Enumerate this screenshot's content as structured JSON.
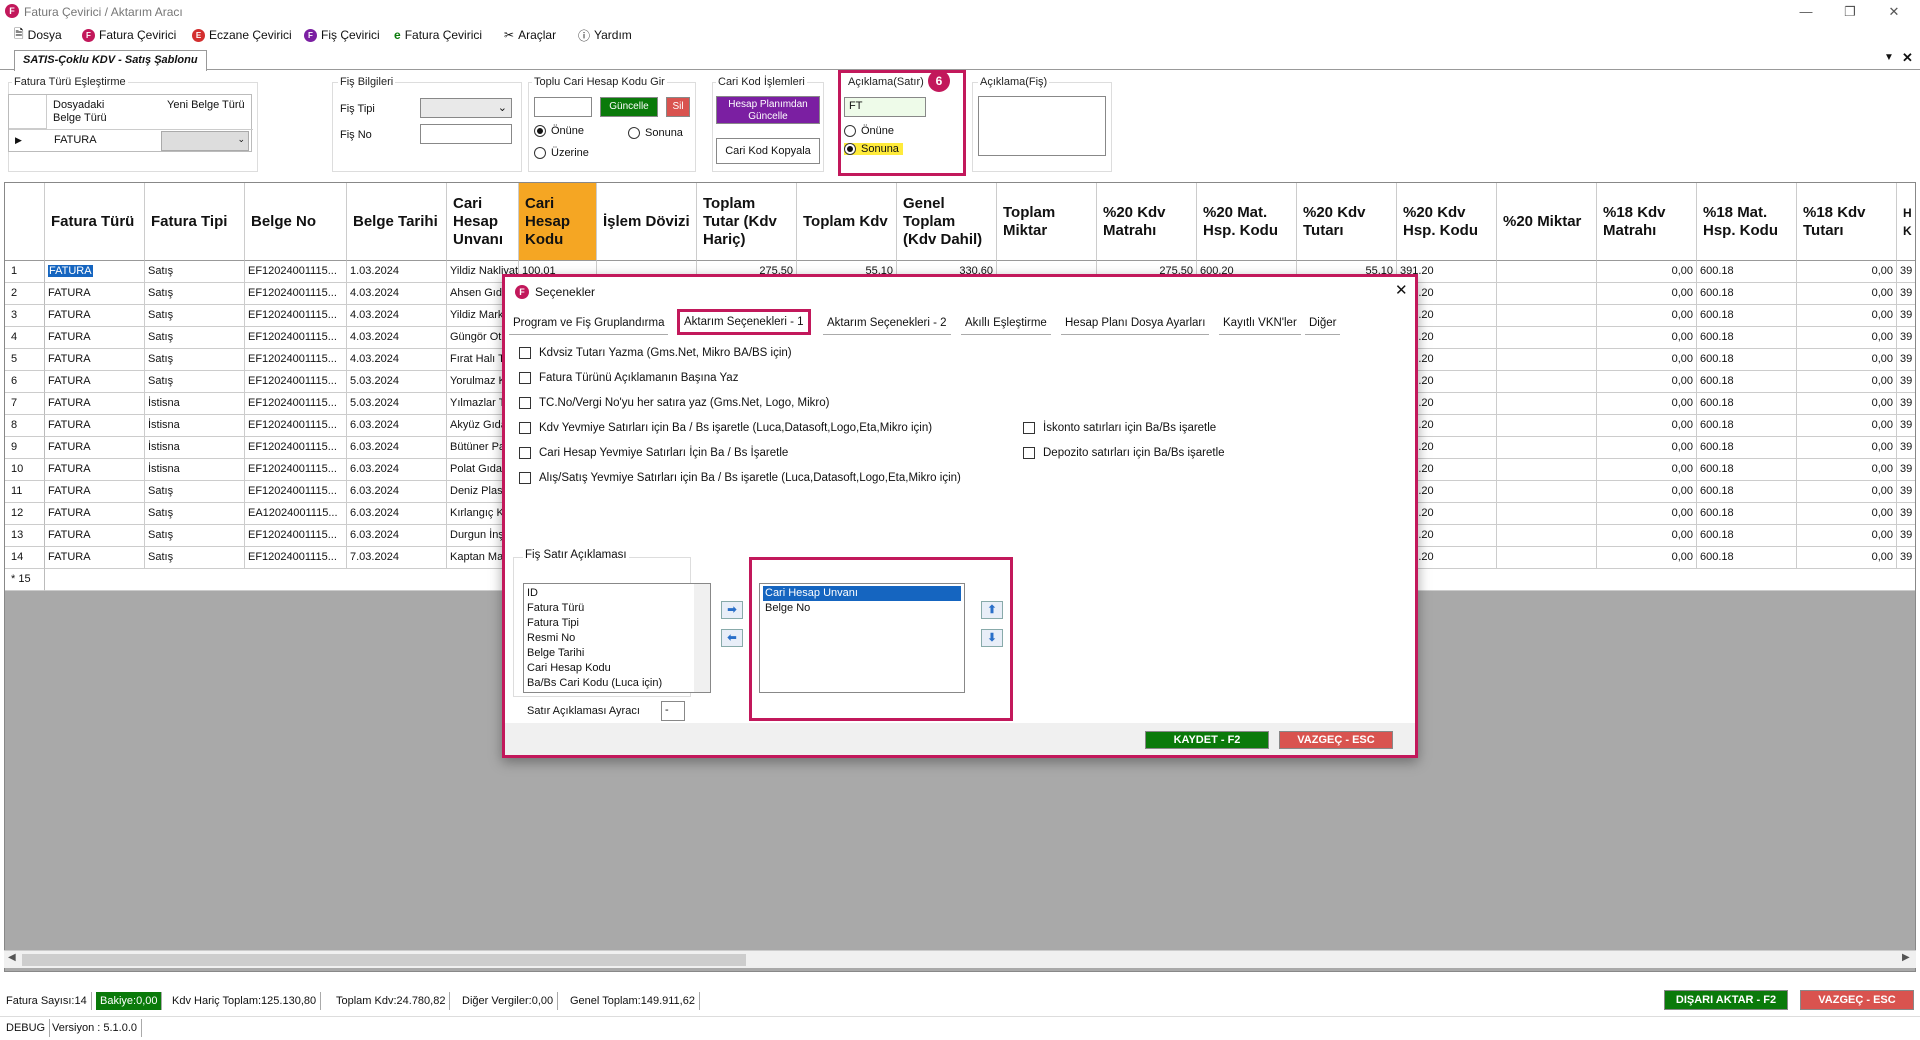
{
  "app": {
    "title": "Fatura Çevirici / Aktarım Aracı"
  },
  "menu": {
    "items": [
      "Dosya",
      "Fatura Çevirici",
      "Eczane Çevirici",
      "Fiş Çevirici",
      "Fatura Çevirici",
      "Araçlar",
      "Yardım"
    ]
  },
  "doc_tab": "SATIS-Çoklu KDV - Satış Şablonu",
  "toolbar": {
    "fatura_turu_group": "Fatura Türü Eşleştirme",
    "col_dosya": "Dosyadaki Belge Türü",
    "col_yeni": "Yeni Belge Türü",
    "row_value": "FATURA",
    "fis_group": "Fiş Bilgileri",
    "fis_tipi": "Fiş Tipi",
    "fis_no": "Fiş No",
    "toplu_group": "Toplu Cari Hesap Kodu Gir",
    "guncelle": "Güncelle",
    "sil": "Sil",
    "onune": "Önüne",
    "sonuna": "Sonuna",
    "uzerine": "Üzerine",
    "cari_group": "Cari Kod İşlemleri",
    "hesap_plan": "Hesap Planımdan Güncelle",
    "cari_kopyala": "Cari Kod Kopyala",
    "aciklama_satir": "Açıklama(Satır)",
    "aciklama_value": "FT",
    "badge": "6",
    "aciklama_fis": "Açıklama(Fiş)"
  },
  "grid": {
    "headers": [
      "Fatura Türü",
      "Fatura Tipi",
      "Belge No",
      "Belge Tarihi",
      "Cari Hesap Unvanı",
      "Cari Hesap Kodu",
      "İşlem Dövizi",
      "Toplam Tutar (Kdv Hariç)",
      "Toplam Kdv",
      "Genel Toplam (Kdv Dahil)",
      "Toplam Miktar",
      "%20 Kdv Matrahı",
      "%20 Mat. Hsp. Kodu",
      "%20 Kdv Tutarı",
      "%20 Kdv Hsp. Kodu",
      "%20 Miktar",
      "%18 Kdv Matrahı",
      "%18 Mat. Hsp. Kodu",
      "%18 Kdv Tutarı",
      "H K"
    ],
    "rows": [
      [
        "1",
        "FATURA",
        "Satış",
        "EF12024001115...",
        "1.03.2024",
        "Yildiz Nakliyat",
        "100.01",
        "",
        "275,50",
        "55,10",
        "330,60",
        "",
        "275,50",
        "600.20",
        "55,10",
        "391.20",
        "",
        "0,00",
        "600.18",
        "0,00",
        "39"
      ],
      [
        "2",
        "FATURA",
        "Satış",
        "EF12024001115...",
        "4.03.2024",
        "Ahsen Gıd...",
        "",
        "",
        "",
        "",
        "",
        "",
        "",
        "",
        "",
        "391.20",
        "",
        "0,00",
        "600.18",
        "0,00",
        "39"
      ],
      [
        "3",
        "FATURA",
        "Satış",
        "EF12024001115...",
        "4.03.2024",
        "Yildiz Mark...",
        "",
        "",
        "",
        "",
        "",
        "",
        "",
        "",
        "",
        "391.20",
        "",
        "0,00",
        "600.18",
        "0,00",
        "39"
      ],
      [
        "4",
        "FATURA",
        "Satış",
        "EF12024001115...",
        "4.03.2024",
        "Güngör Ot...",
        "",
        "",
        "",
        "",
        "",
        "",
        "",
        "",
        "",
        "391.20",
        "",
        "0,00",
        "600.18",
        "0,00",
        "39"
      ],
      [
        "5",
        "FATURA",
        "Satış",
        "EF12024001115...",
        "4.03.2024",
        "Fırat Halı T...",
        "",
        "",
        "",
        "",
        "",
        "",
        "",
        "",
        "",
        "391.20",
        "",
        "0,00",
        "600.18",
        "0,00",
        "39"
      ],
      [
        "6",
        "FATURA",
        "Satış",
        "EF12024001115...",
        "5.03.2024",
        "Yorulmaz K...",
        "",
        "",
        "",
        "",
        "",
        "",
        "",
        "",
        "",
        "391.20",
        "",
        "0,00",
        "600.18",
        "0,00",
        "39"
      ],
      [
        "7",
        "FATURA",
        "İstisna",
        "EF12024001115...",
        "5.03.2024",
        "Yılmazlar T...",
        "",
        "",
        "",
        "",
        "",
        "",
        "",
        "",
        "",
        "391.20",
        "",
        "0,00",
        "600.18",
        "0,00",
        "39"
      ],
      [
        "8",
        "FATURA",
        "İstisna",
        "EF12024001115...",
        "6.03.2024",
        "Akyüz Gıda...",
        "",
        "",
        "",
        "",
        "",
        "",
        "",
        "",
        "",
        "391.20",
        "",
        "0,00",
        "600.18",
        "0,00",
        "39"
      ],
      [
        "9",
        "FATURA",
        "İstisna",
        "EF12024001115...",
        "6.03.2024",
        "Bütüner Pa...",
        "",
        "",
        "",
        "",
        "",
        "",
        "",
        "",
        "",
        "391.20",
        "",
        "0,00",
        "600.18",
        "0,00",
        "39"
      ],
      [
        "10",
        "FATURA",
        "İstisna",
        "EF12024001115...",
        "6.03.2024",
        "Polat Gıda ...",
        "",
        "",
        "",
        "",
        "",
        "",
        "",
        "",
        "",
        "391.20",
        "",
        "0,00",
        "600.18",
        "0,00",
        "39"
      ],
      [
        "11",
        "FATURA",
        "Satış",
        "EF12024001115...",
        "6.03.2024",
        "Deniz Plast...",
        "",
        "",
        "",
        "",
        "",
        "",
        "",
        "",
        "",
        "391.20",
        "",
        "0,00",
        "600.18",
        "0,00",
        "39"
      ],
      [
        "12",
        "FATURA",
        "Satış",
        "EA12024001115...",
        "6.03.2024",
        "Kırlangıç Ki...",
        "",
        "",
        "",
        "",
        "",
        "",
        "",
        "",
        "",
        "391.20",
        "",
        "0,00",
        "600.18",
        "0,00",
        "39"
      ],
      [
        "13",
        "FATURA",
        "Satış",
        "EF12024001115...",
        "6.03.2024",
        "Durgun İnş...",
        "",
        "",
        "",
        "",
        "",
        "",
        "",
        "",
        "",
        "391.20",
        "",
        "0,00",
        "600.18",
        "0,00",
        "39"
      ],
      [
        "14",
        "FATURA",
        "Satış",
        "EF12024001115...",
        "7.03.2024",
        "Kaptan Ma...",
        "",
        "",
        "",
        "",
        "",
        "",
        "",
        "",
        "",
        "391.20",
        "",
        "0,00",
        "600.18",
        "0,00",
        "39"
      ]
    ],
    "new_row": "* 15"
  },
  "status": {
    "items": [
      "Fatura Sayısı:14",
      "Bakiye:0,00",
      "Kdv Hariç Toplam:125.130,80",
      "Toplam Kdv:24.780,82",
      "Diğer Vergiler:0,00",
      "Genel Toplam:149.911,62"
    ],
    "debug": "DEBUG",
    "version": "Versiyon : 5.1.0.0",
    "disari": "DIŞARI AKTAR - F2",
    "vazgec": "VAZGEÇ - ESC"
  },
  "dialog": {
    "title": "Seçenekler",
    "tabs": [
      "Program ve Fiş Gruplandırma",
      "Aktarım Seçenekleri - 1",
      "Aktarım Seçenekleri - 2",
      "Akıllı Eşleştirme",
      "Hesap Planı Dosya Ayarları",
      "Kayıtlı VKN'ler",
      "Diğer"
    ],
    "checks_left": [
      "Kdvsiz Tutarı Yazma (Gms.Net, Mikro BA/BS için)",
      "Fatura Türünü Açıklamanın Başına Yaz",
      "TC.No/Vergi No'yu her satıra yaz (Gms.Net, Logo, Mikro)",
      "Kdv Yevmiye Satırları için Ba / Bs işaretle (Luca,Datasoft,Logo,Eta,Mikro için)",
      "Cari Hesap Yevmiye Satırları İçin Ba / Bs İşaretle",
      "Alış/Satış Yevmiye Satırları için Ba / Bs işaretle (Luca,Datasoft,Logo,Eta,Mikro için)"
    ],
    "checks_right": [
      "İskonto satırları için Ba/Bs işaretle",
      "Depozito satırları için Ba/Bs işaretle"
    ],
    "fis_group": "Fiş Satır Açıklaması",
    "available": [
      "ID",
      "Fatura Türü",
      "Fatura Tipi",
      "Resmi No",
      "Belge Tarihi",
      "Cari Hesap Kodu",
      "Ba/Bs Cari Kodu (Luca için)"
    ],
    "selected": [
      "Cari Hesap Unvanı",
      "Belge No"
    ],
    "ayrac_label": "Satır Açıklaması Ayracı",
    "ayrac_value": "-",
    "kaydet": "KAYDET - F2",
    "vazgec": "VAZGEÇ - ESC"
  },
  "colors": {
    "accent": "#c2185b",
    "green": "#0a7a0a",
    "red": "#d9534f",
    "orange": "#f5a623",
    "purple": "#7b1fa2"
  }
}
